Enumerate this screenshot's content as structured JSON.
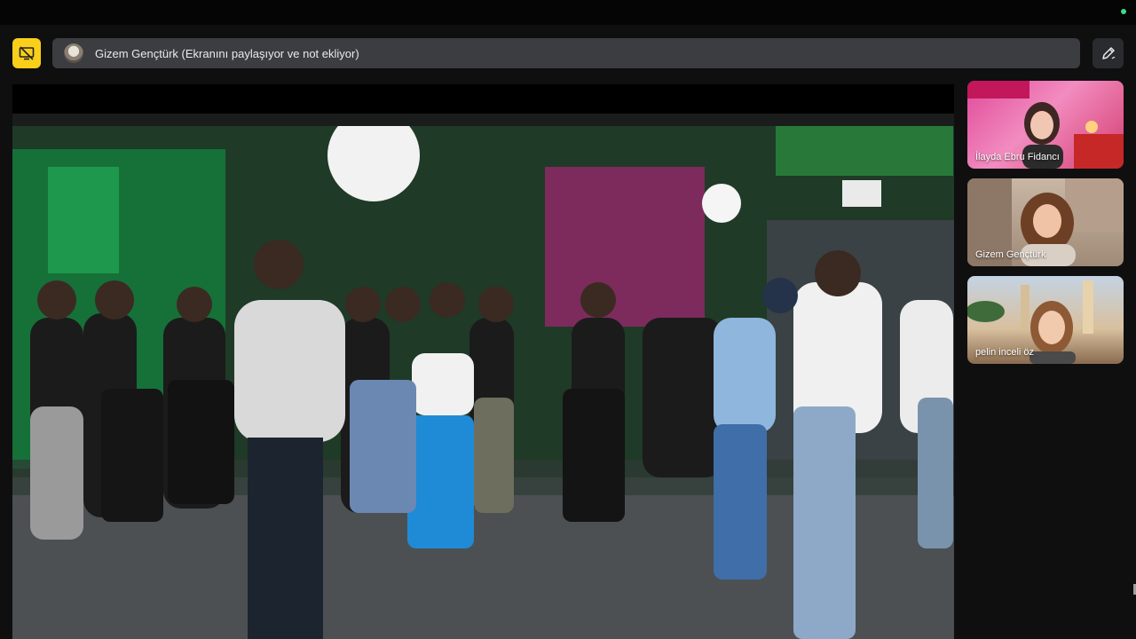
{
  "presenter_banner": {
    "text": "Gizem Gençtürk (Ekranını paylaşıyor ve not ekliyor)"
  },
  "controls": {
    "stop_share_icon": "screen-share-off-icon",
    "annotate_icon": "pencil-annotate-icon"
  },
  "participants": [
    {
      "name": "İlayda Ebru Fidancı"
    },
    {
      "name": "Gizem Gençtürk"
    },
    {
      "name": "pelin inceli öz"
    }
  ],
  "colors": {
    "accent_yellow": "#f9cf1a",
    "banner_bg": "#3b3d40",
    "status_dot": "#3ddc84"
  }
}
